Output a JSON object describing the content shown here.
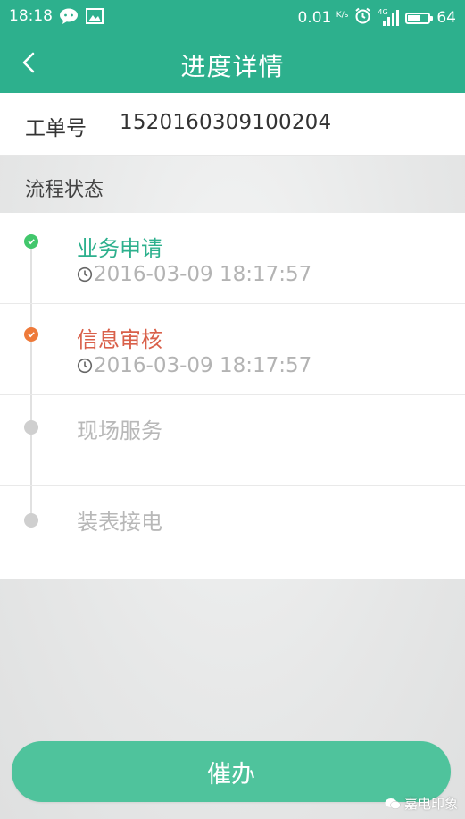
{
  "status_bar": {
    "time": "18:18",
    "speed": "0.01",
    "speed_unit": "K/s",
    "signal_label": "4G",
    "battery": "64",
    "battery_level": 0.64
  },
  "navbar": {
    "title": "进度详情",
    "back_icon": "chevron-left-icon"
  },
  "order": {
    "label": "工单号",
    "number": "1520160309100204"
  },
  "process": {
    "section_title": "流程状态",
    "steps": [
      {
        "name": "业务申请",
        "time": "2016-03-09 18:17:57",
        "status": "done",
        "color": "#2db08d"
      },
      {
        "name": "信息审核",
        "time": "2016-03-09 18:17:57",
        "status": "current",
        "color": "#e06a4a"
      },
      {
        "name": "现场服务",
        "time": "",
        "status": "pending",
        "color": "#b8b8b8"
      },
      {
        "name": "装表接电",
        "time": "",
        "status": "pending",
        "color": "#b8b8b8"
      }
    ]
  },
  "actions": {
    "urge_label": "催办"
  },
  "watermark": {
    "text": "嘉电印象"
  },
  "colors": {
    "primary": "#2db08d",
    "button": "#4fc39c",
    "done_dot": "#42c76c",
    "current_dot": "#ee7a3a",
    "pending_dot": "#cfcfcf"
  }
}
